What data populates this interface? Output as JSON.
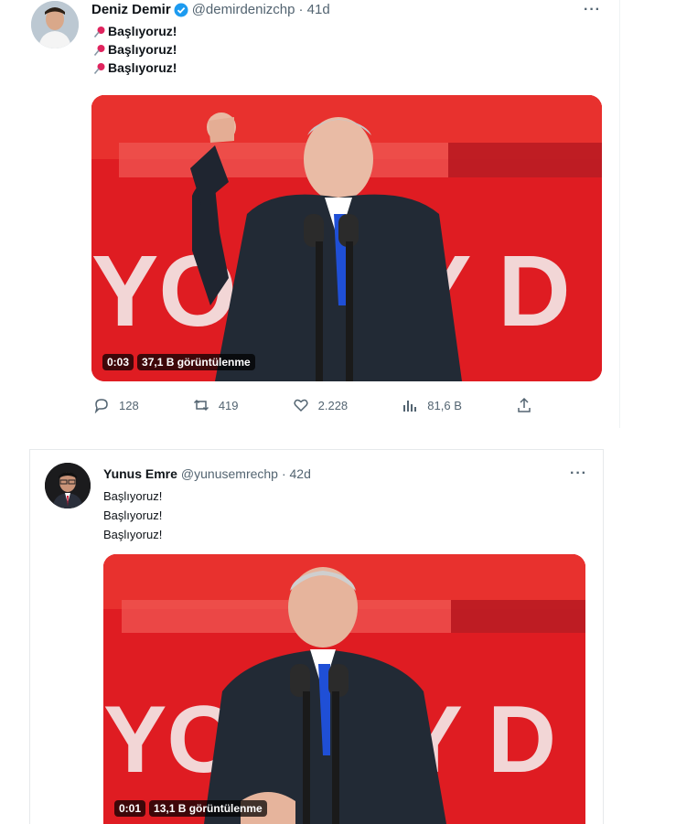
{
  "tweets": [
    {
      "author_name": "Deniz Demir",
      "handle": "@demirdenizchp",
      "age": "· 41d",
      "verified": true,
      "lines": [
        "Başlıyoruz!",
        "Başlıyoruz!",
        "Başlıyoruz!"
      ],
      "line_icon": "pushpin-icon",
      "video_time": "0:03",
      "video_views": "37,1 B görüntülenme",
      "stats": {
        "replies": "128",
        "retweets": "419",
        "likes": "2.228",
        "views": "81,6 B"
      }
    },
    {
      "author_name": "Yunus Emre",
      "handle": "@yunusemrechp",
      "age": "· 42d",
      "verified": false,
      "lines": [
        "Başlıyoruz!",
        "Başlıyoruz!",
        "Başlıyoruz!"
      ],
      "video_time": "0:01",
      "video_views": "13,1 B görüntülenme"
    }
  ],
  "more_label": "···",
  "video_backdrop_text": "YOR    EY D",
  "colors": {
    "video_red": "#e01a23",
    "verified_blue": "#1d9bf0",
    "muted": "#536471"
  }
}
